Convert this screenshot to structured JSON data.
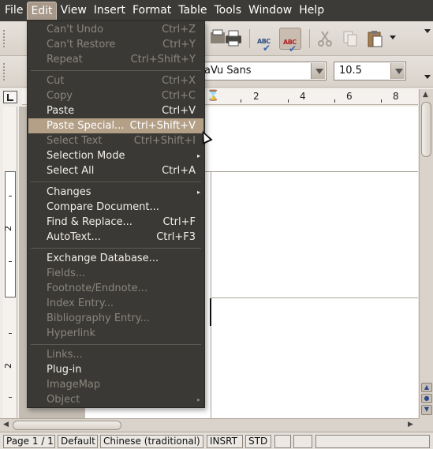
{
  "menubar": {
    "items": [
      "File",
      "Edit",
      "View",
      "Insert",
      "Format",
      "Table",
      "Tools",
      "Window",
      "Help"
    ],
    "active": "Edit"
  },
  "toolbar": {
    "font_name": "aVu Sans",
    "font_size": "10.5",
    "spell_label": "ABC"
  },
  "ruler": {
    "h_numbers": [
      "2",
      "4",
      "6",
      "8"
    ],
    "v_numbers": [
      "2",
      "2"
    ]
  },
  "edit_menu": {
    "items": [
      {
        "label": "Can't Undo",
        "accel": "Ctrl+Z",
        "enabled": false
      },
      {
        "label": "Can't Restore",
        "accel": "Ctrl+Y",
        "enabled": false
      },
      {
        "label": "Repeat",
        "accel": "Ctrl+Shift+Y",
        "enabled": false
      },
      {
        "label": "Cut",
        "accel": "Ctrl+X",
        "enabled": false
      },
      {
        "label": "Copy",
        "accel": "Ctrl+C",
        "enabled": false
      },
      {
        "label": "Paste",
        "accel": "Ctrl+V",
        "enabled": true
      },
      {
        "label": "Paste Special...",
        "accel": "Ctrl+Shift+V",
        "enabled": true,
        "highlighted": true
      },
      {
        "label": "Select Text",
        "accel": "Ctrl+Shift+I",
        "enabled": false
      },
      {
        "label": "Selection Mode",
        "accel": "",
        "enabled": true,
        "submenu": true
      },
      {
        "label": "Select All",
        "accel": "Ctrl+A",
        "enabled": true
      },
      {
        "label": "Changes",
        "accel": "",
        "enabled": true,
        "submenu": true
      },
      {
        "label": "Compare Document...",
        "accel": "",
        "enabled": true
      },
      {
        "label": "Find & Replace...",
        "accel": "Ctrl+F",
        "enabled": true
      },
      {
        "label": "AutoText...",
        "accel": "Ctrl+F3",
        "enabled": true
      },
      {
        "label": "Exchange Database...",
        "accel": "",
        "enabled": true
      },
      {
        "label": "Fields...",
        "accel": "",
        "enabled": false
      },
      {
        "label": "Footnote/Endnote...",
        "accel": "",
        "enabled": false
      },
      {
        "label": "Index Entry...",
        "accel": "",
        "enabled": false
      },
      {
        "label": "Bibliography Entry...",
        "accel": "",
        "enabled": false
      },
      {
        "label": "Hyperlink",
        "accel": "",
        "enabled": false
      },
      {
        "label": "Links...",
        "accel": "",
        "enabled": false
      },
      {
        "label": "Plug-in",
        "accel": "",
        "enabled": true
      },
      {
        "label": "ImageMap",
        "accel": "",
        "enabled": false
      },
      {
        "label": "Object",
        "accel": "",
        "enabled": false,
        "submenu": true
      }
    ]
  },
  "statusbar": {
    "page": "Page 1 / 1",
    "style": "Default",
    "language": "Chinese (traditional)",
    "insert_mode": "INSRT",
    "selection_mode": "STD"
  },
  "colors": {
    "menubar_bg": "#3d3b37",
    "menu_bg": "#3b3935",
    "menu_highlight": "#b49f87",
    "disabled_text": "#8a857e"
  }
}
